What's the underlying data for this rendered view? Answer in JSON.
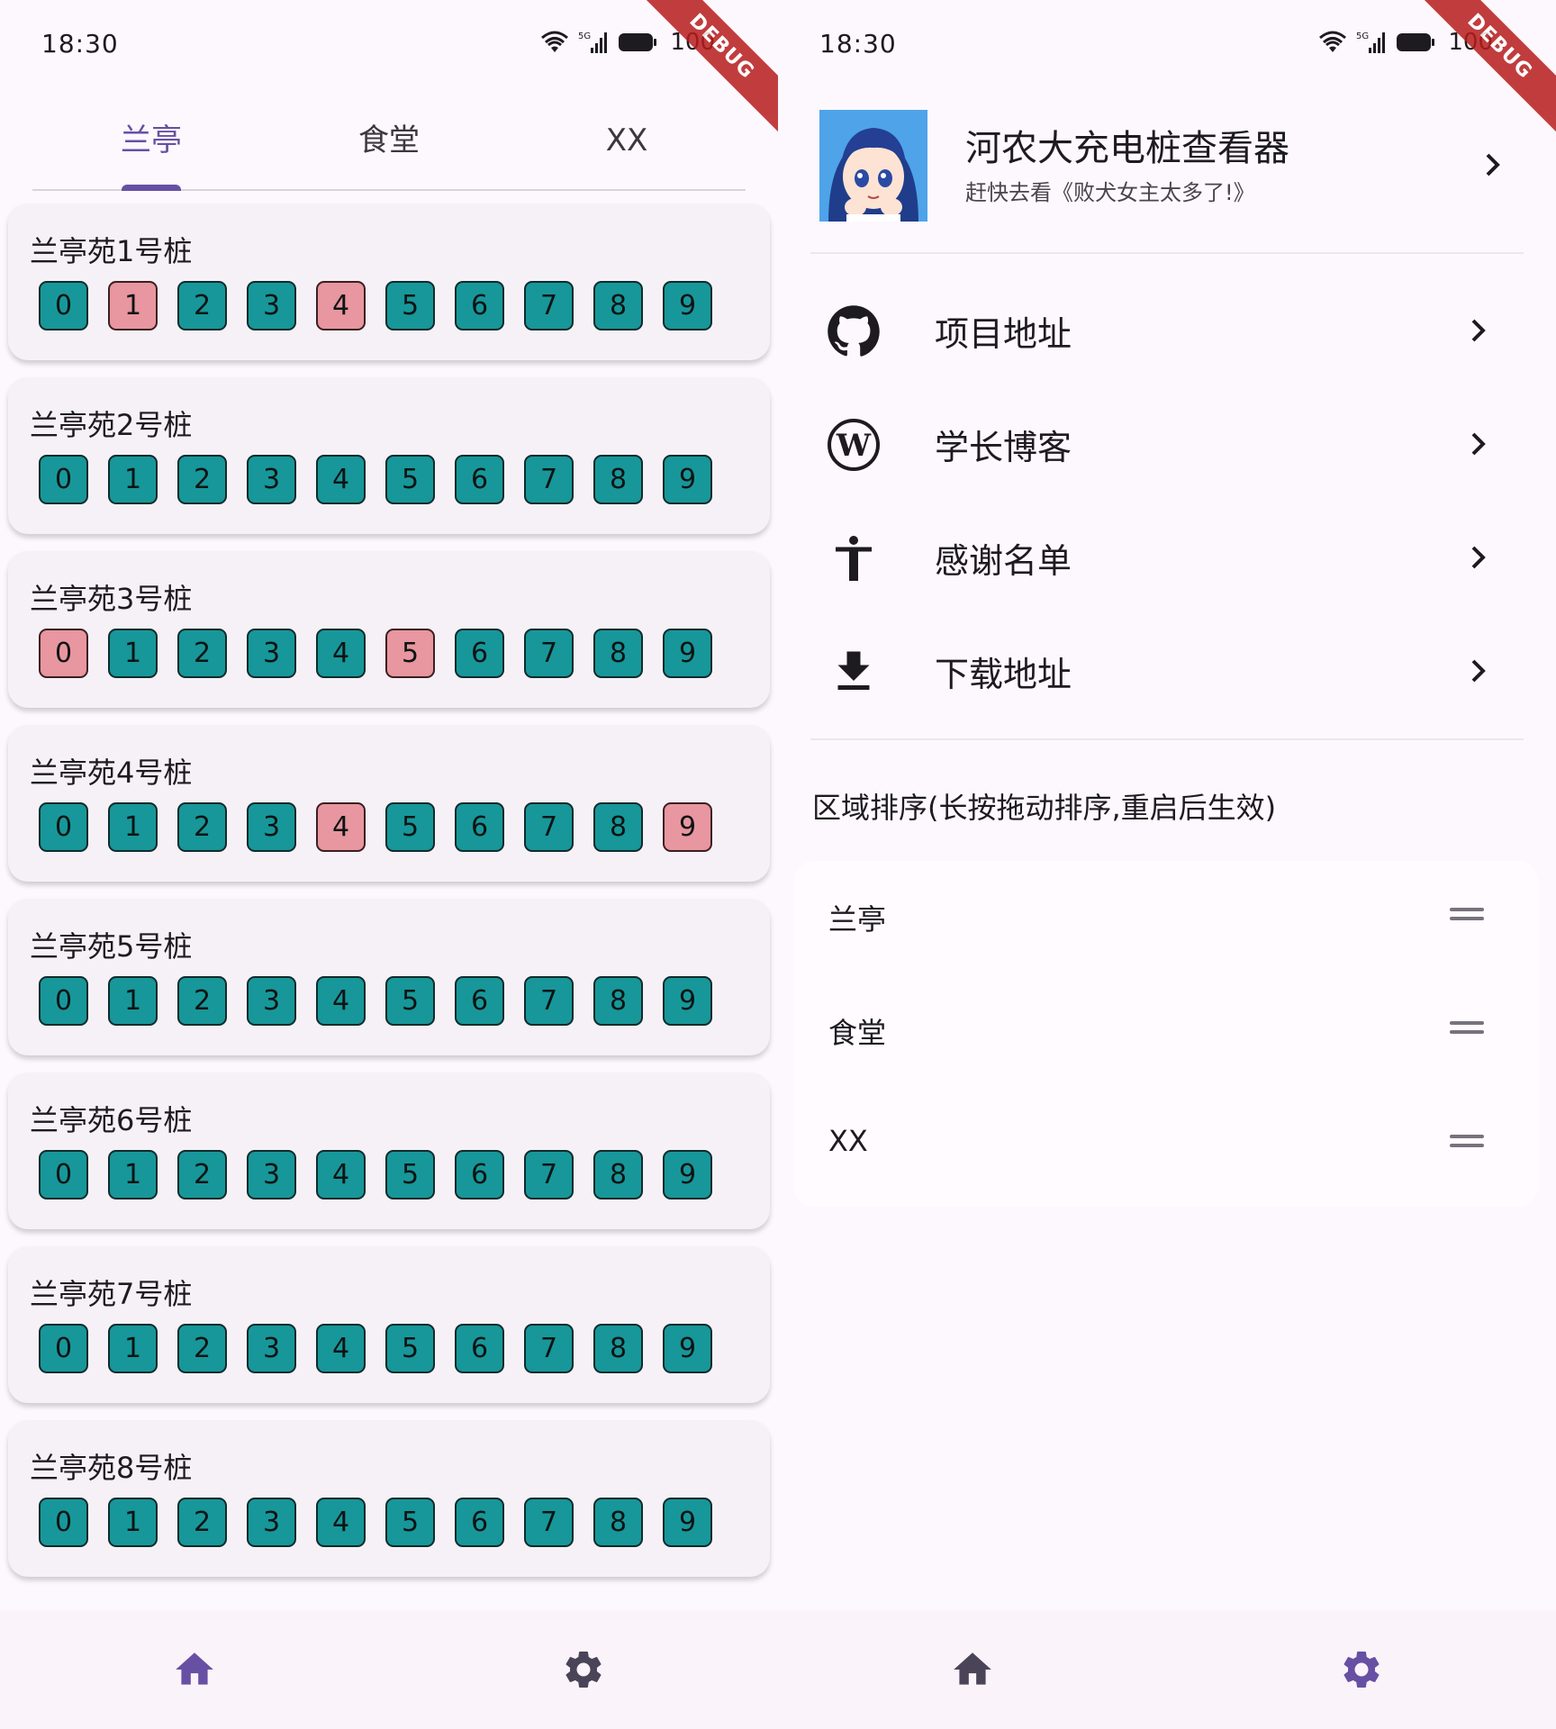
{
  "status": {
    "time": "18:30",
    "battery": "100",
    "net": "5G"
  },
  "debug_banner": "DEBUG",
  "home": {
    "tabs": [
      "兰亭",
      "食堂",
      "XX"
    ],
    "active_tab": 0,
    "piles": [
      {
        "name": "兰亭苑1号桩",
        "busy": [
          1,
          4
        ]
      },
      {
        "name": "兰亭苑2号桩",
        "busy": []
      },
      {
        "name": "兰亭苑3号桩",
        "busy": [
          0,
          5
        ]
      },
      {
        "name": "兰亭苑4号桩",
        "busy": [
          4,
          9
        ]
      },
      {
        "name": "兰亭苑5号桩",
        "busy": []
      },
      {
        "name": "兰亭苑6号桩",
        "busy": []
      },
      {
        "name": "兰亭苑7号桩",
        "busy": []
      },
      {
        "name": "兰亭苑8号桩",
        "busy": []
      }
    ],
    "slot_labels": [
      "0",
      "1",
      "2",
      "3",
      "4",
      "5",
      "6",
      "7",
      "8",
      "9"
    ]
  },
  "settings": {
    "app_title": "河农大充电桩查看器",
    "app_subtitle": "赶快去看《败犬女主太多了!》",
    "menu": [
      {
        "label": "项目地址",
        "icon": "github-icon"
      },
      {
        "label": "学长博客",
        "icon": "wordpress-icon"
      },
      {
        "label": "感谢名单",
        "icon": "accessibility-icon"
      },
      {
        "label": "下载地址",
        "icon": "download-icon"
      }
    ],
    "order_title": "区域排序(长按拖动排序,重启后生效)",
    "order_items": [
      "兰亭",
      "食堂",
      "XX"
    ]
  },
  "nav": {
    "items": [
      "home-icon",
      "settings-icon"
    ]
  },
  "colors": {
    "accent": "#6750a4",
    "free": "#17979a",
    "busy": "#e8969f",
    "nav_inactive": "#4a4458"
  }
}
